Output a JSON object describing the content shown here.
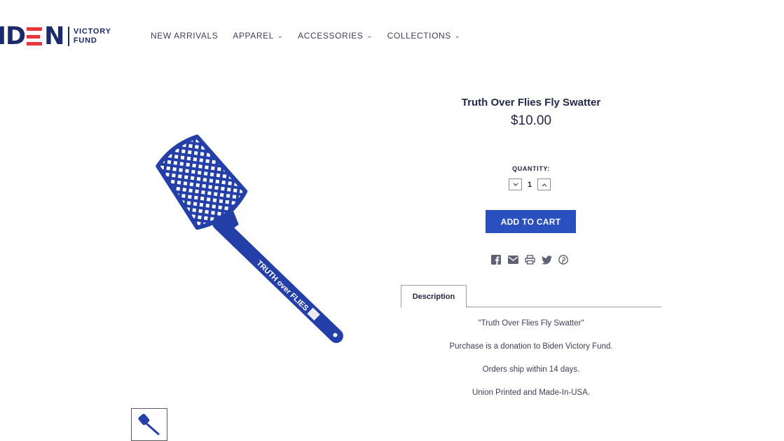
{
  "brand": {
    "logo_text_left": "ID",
    "logo_text_right": "N",
    "logo_sub_line1": "VICTORY",
    "logo_sub_line2": "FUND",
    "accent": "#e8343c",
    "navy": "#1b2a6b"
  },
  "nav": {
    "items": [
      {
        "label": "NEW ARRIVALS",
        "has_dropdown": false
      },
      {
        "label": "APPAREL",
        "has_dropdown": true
      },
      {
        "label": "ACCESSORIES",
        "has_dropdown": true
      },
      {
        "label": "COLLECTIONS",
        "has_dropdown": true
      }
    ],
    "caret_glyph": "⌄"
  },
  "product": {
    "title": "Truth Over Flies Fly Swatter",
    "price": "$10.00",
    "image_text": "TRUTH over FLIES",
    "image_color": "#2440a8",
    "quantity_label": "QUANTITY:",
    "quantity": "1",
    "add_to_cart_label": "ADD TO CART",
    "button_color": "#2a4fbf"
  },
  "share": {
    "icons": [
      "facebook-icon",
      "email-icon",
      "print-icon",
      "twitter-icon",
      "pinterest-icon"
    ]
  },
  "tabs": {
    "description_label": "Description"
  },
  "description": {
    "lines": [
      "\"Truth Over Flies Fly Swatter\"",
      "Purchase is a donation to Biden Victory Fund.",
      "Orders ship within 14 days.",
      "Union Printed and Made-In-USA."
    ]
  }
}
